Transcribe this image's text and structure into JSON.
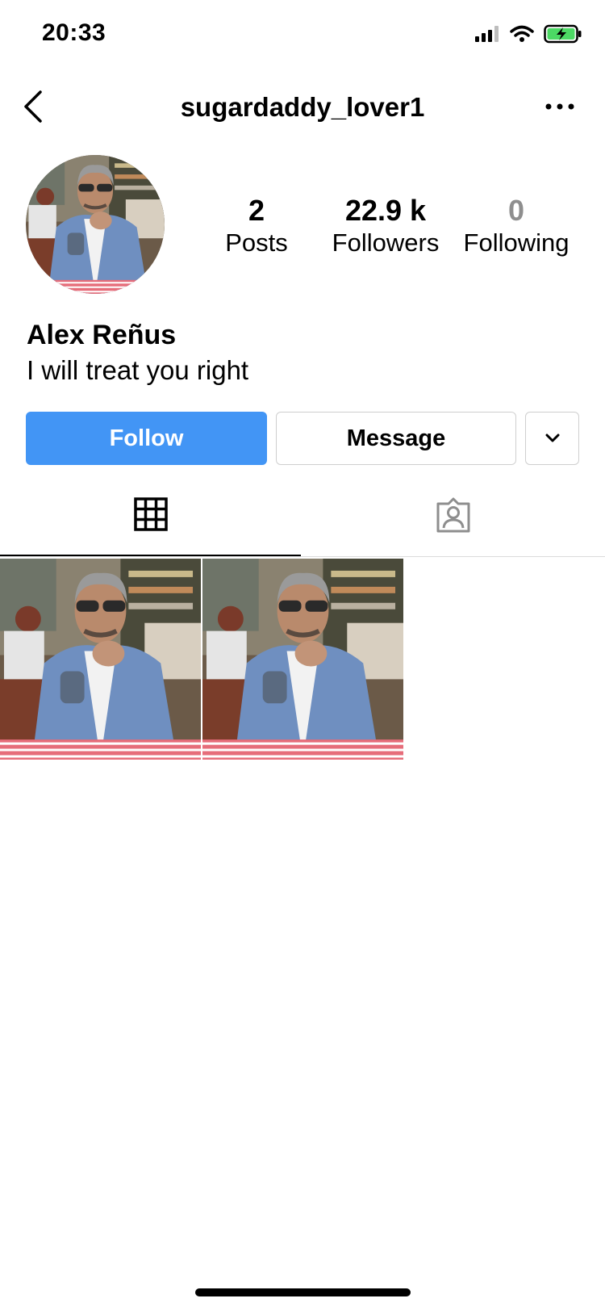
{
  "status_bar": {
    "time": "20:33",
    "icons": [
      "cellular-signal-icon",
      "wifi-icon",
      "battery-charging-icon"
    ],
    "battery_color": "#4cd964"
  },
  "header": {
    "username": "sugardaddy_lover1",
    "back_icon": "chevron-left-icon",
    "more_icon": "more-horizontal-icon"
  },
  "profile": {
    "avatar_icon": "profile-photo",
    "stats": [
      {
        "value": "2",
        "label": "Posts"
      },
      {
        "value": "22.9 k",
        "label": "Followers"
      },
      {
        "value": "0",
        "label": "Following"
      }
    ],
    "display_name": "Alex Reñus",
    "bio": "I will treat you right"
  },
  "actions": {
    "follow_label": "Follow",
    "message_label": "Message",
    "dropdown_icon": "chevron-down-icon",
    "follow_color": "#4295f5"
  },
  "tabs": [
    {
      "name": "posts-grid",
      "icon": "grid-icon",
      "active": true
    },
    {
      "name": "tagged",
      "icon": "tagged-person-icon",
      "active": false
    }
  ],
  "posts": [
    {
      "thumbnail": "photo-man-sunglasses-blue-blazer"
    },
    {
      "thumbnail": "photo-man-sunglasses-blue-blazer"
    }
  ]
}
